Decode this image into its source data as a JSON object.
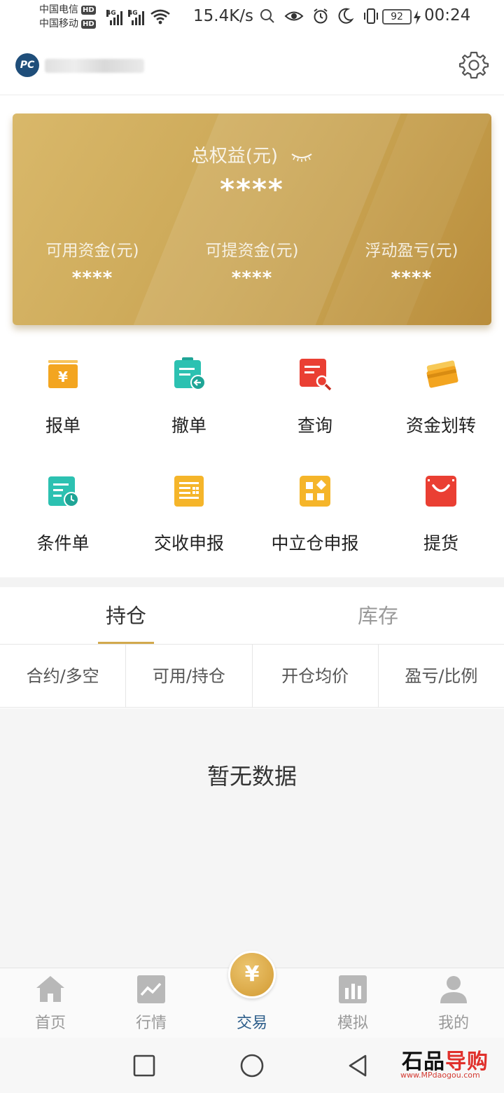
{
  "status_bar": {
    "carrier_1": "中国电信",
    "carrier_2": "中国移动",
    "hd_badge": "HD",
    "net_type": "4G",
    "speed": "15.4K/s",
    "battery": "92",
    "time": "00:24"
  },
  "header": {
    "logo_text": "PC",
    "settings_icon": "gear-icon"
  },
  "equity_card": {
    "total_label": "总权益(元)",
    "total_value": "****",
    "items": [
      {
        "label": "可用资金(元)",
        "value": "****"
      },
      {
        "label": "可提资金(元)",
        "value": "****"
      },
      {
        "label": "浮动盈亏(元)",
        "value": "****"
      }
    ]
  },
  "functions": [
    {
      "label": "报单",
      "icon": "yuan-order-icon",
      "color": "#f3a520"
    },
    {
      "label": "撤单",
      "icon": "cancel-order-icon",
      "color": "#2cc1b1"
    },
    {
      "label": "查询",
      "icon": "query-icon",
      "color": "#ea3f33"
    },
    {
      "label": "资金划转",
      "icon": "card-transfer-icon",
      "color": "#f5b52a"
    },
    {
      "label": "条件单",
      "icon": "conditional-order-icon",
      "color": "#2cc1b1"
    },
    {
      "label": "交收申报",
      "icon": "delivery-report-icon",
      "color": "#f5b52a"
    },
    {
      "label": "中立仓申报",
      "icon": "neutral-position-icon",
      "color": "#f5b52a"
    },
    {
      "label": "提货",
      "icon": "pickup-bag-icon",
      "color": "#ea3f33"
    }
  ],
  "tabs": [
    {
      "label": "持仓",
      "active": true
    },
    {
      "label": "库存",
      "active": false
    }
  ],
  "columns": [
    "合约/多空",
    "可用/持仓",
    "开仓均价",
    "盈亏/比例"
  ],
  "empty_text": "暂无数据",
  "bottom_nav": [
    {
      "label": "首页",
      "icon": "home-icon",
      "active": false
    },
    {
      "label": "行情",
      "icon": "market-chart-icon",
      "active": false
    },
    {
      "label": "交易",
      "icon": "yuan-trade-icon",
      "active": true,
      "symbol": "¥"
    },
    {
      "label": "模拟",
      "icon": "simulation-bars-icon",
      "active": false
    },
    {
      "label": "我的",
      "icon": "profile-icon",
      "active": false
    }
  ],
  "colors": {
    "accent_gold": "#d2a94d",
    "active_nav": "#2c5d8a"
  },
  "watermark": {
    "main_a": "石品",
    "main_b": "导购",
    "url": "www.MPdaogou.com"
  }
}
